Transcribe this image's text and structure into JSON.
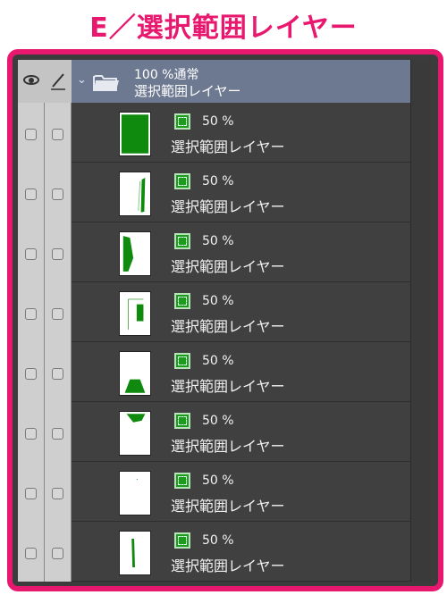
{
  "heading": "E／選択範囲レイヤー",
  "folder": {
    "mode": "100 %通常",
    "name": "選択範囲レイヤー"
  },
  "layers": [
    {
      "opacity": "50 %",
      "name": "選択範囲レイヤー"
    },
    {
      "opacity": "50 %",
      "name": "選択範囲レイヤー"
    },
    {
      "opacity": "50 %",
      "name": "選択範囲レイヤー"
    },
    {
      "opacity": "50 %",
      "name": "選択範囲レイヤー"
    },
    {
      "opacity": "50 %",
      "name": "選択範囲レイヤー"
    },
    {
      "opacity": "50 %",
      "name": "選択範囲レイヤー"
    },
    {
      "opacity": "50 %",
      "name": "選択範囲レイヤー"
    },
    {
      "opacity": "50 %",
      "name": "選択範囲レイヤー"
    }
  ],
  "colors": {
    "accent": "#e8186f",
    "selection_green": "#1e9b1e",
    "header_blue": "#6d7891",
    "panel": "#404040"
  }
}
